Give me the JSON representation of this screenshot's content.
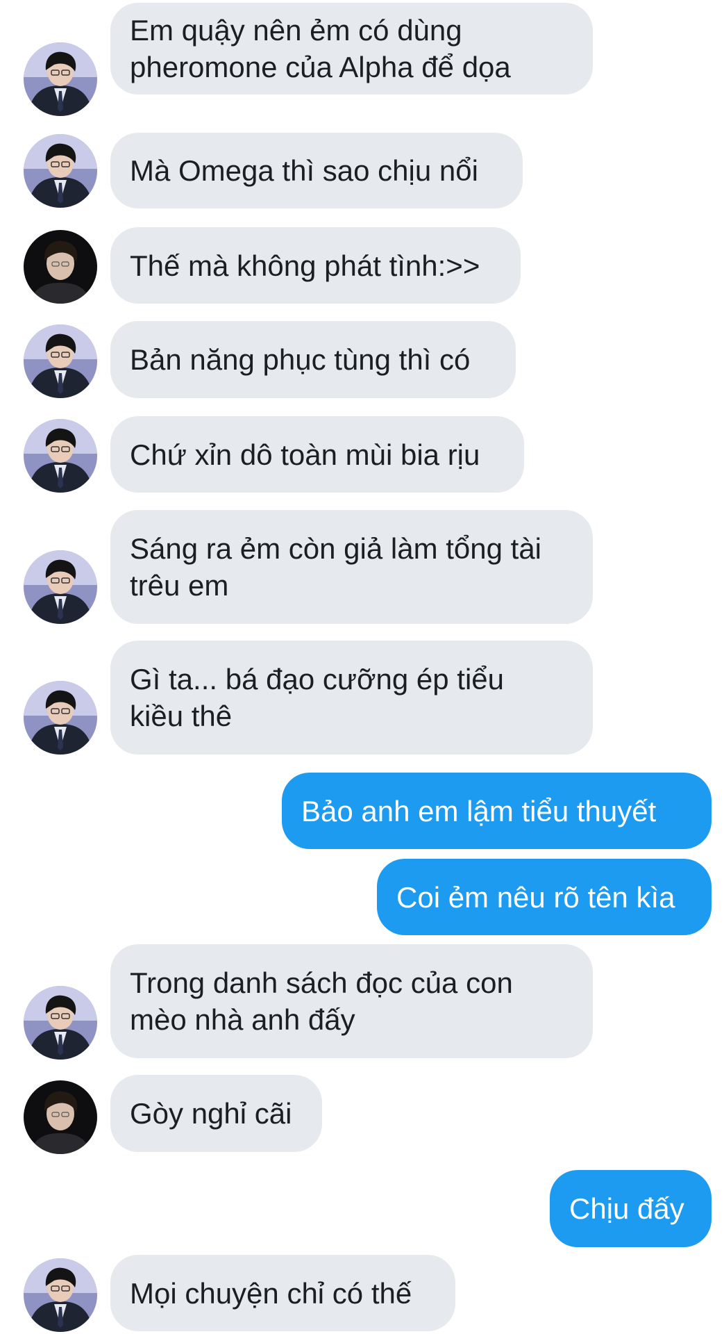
{
  "conversation": {
    "messages": [
      {
        "sender": "other",
        "avatar": "avatar-a",
        "text": "Em quậy nên ẻm có dùng\npheromone của Alpha để dọa"
      },
      {
        "sender": "other",
        "avatar": "avatar-a",
        "text": "Mà Omega thì sao chịu nổi"
      },
      {
        "sender": "other",
        "avatar": "avatar-b",
        "text": "Thế mà không phát tình:>>"
      },
      {
        "sender": "other",
        "avatar": "avatar-a",
        "text": "Bản năng phục tùng thì có"
      },
      {
        "sender": "other",
        "avatar": "avatar-a",
        "text": "Chứ xỉn dô toàn mùi bia rịu"
      },
      {
        "sender": "other",
        "avatar": "avatar-a",
        "text": "Sáng ra ẻm còn giả làm tổng tài\ntrêu em"
      },
      {
        "sender": "other",
        "avatar": "avatar-a",
        "text": "Gì ta... bá đạo cưỡng ép tiểu\nkiều thê"
      },
      {
        "sender": "me",
        "text": "Bảo anh em lậm tiểu thuyết"
      },
      {
        "sender": "me",
        "text": "Coi ẻm nêu rõ tên kìa"
      },
      {
        "sender": "other",
        "avatar": "avatar-a",
        "text": "Trong danh sách đọc của con\nmèo nhà anh đấy"
      },
      {
        "sender": "other",
        "avatar": "avatar-b",
        "text": "Gòy nghỉ cãi"
      },
      {
        "sender": "me",
        "text": "Chịu đấy"
      },
      {
        "sender": "other",
        "avatar": "avatar-a",
        "text": "Mọi chuyện chỉ có thế"
      }
    ]
  },
  "colors": {
    "incoming_bubble": "#e6e9ed",
    "incoming_text": "#1c1e21",
    "outgoing_bubble": "#1d9bf0",
    "outgoing_text": "#ffffff",
    "background": "#ffffff"
  }
}
